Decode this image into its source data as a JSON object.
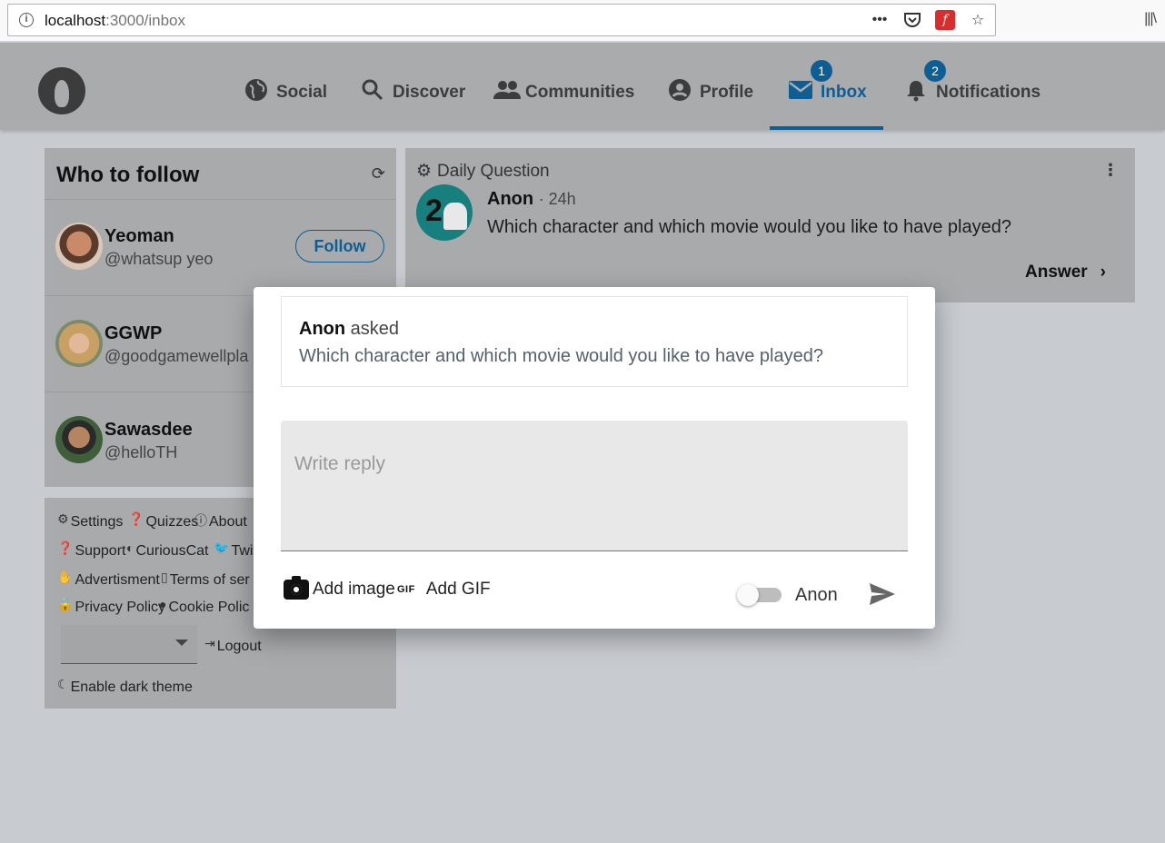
{
  "browser": {
    "url_host": "localhost",
    "url_rest": ":3000/inbox",
    "more_icon": "•••"
  },
  "nav": {
    "items": [
      {
        "label": "Social",
        "icon": "globe-icon"
      },
      {
        "label": "Discover",
        "icon": "search-icon"
      },
      {
        "label": "Communities",
        "icon": "people-icon"
      },
      {
        "label": "Profile",
        "icon": "account-icon"
      },
      {
        "label": "Inbox",
        "icon": "mail-icon",
        "badge": "1",
        "active": true
      },
      {
        "label": "Notifications",
        "icon": "bell-icon",
        "badge": "2"
      }
    ]
  },
  "who_to_follow": {
    "title": "Who to follow",
    "people": [
      {
        "name": "Yeoman",
        "handle": "@whatsup yeo",
        "button": "Follow"
      },
      {
        "name": "GGWP",
        "handle": "@goodgamewellpla"
      },
      {
        "name": "Sawasdee",
        "handle": "@helloTH"
      }
    ]
  },
  "footer_links": {
    "settings": "Settings",
    "quizzes": "Quizzes",
    "about": "About",
    "support": "Support",
    "curiouscat": "CuriousCat",
    "twitter": "Twit",
    "advertisment": "Advertisment",
    "terms": "Terms of ser",
    "privacy": "Privacy Policy",
    "cookie": "Cookie Polic",
    "logout": "Logout",
    "dark_theme": "Enable dark theme"
  },
  "daily_question": {
    "label": "Daily Question",
    "author": "Anon",
    "time": "· 24h",
    "question": "Which character and which movie would you like to have played?",
    "answer": "Answer"
  },
  "modal": {
    "asker": "Anon",
    "asked": "asked",
    "question": "Which character and which movie would you like to have played?",
    "reply_placeholder": "Write reply",
    "add_image": "Add image",
    "gif_icon": "GIF",
    "add_gif": "Add GIF",
    "anon_label": "Anon"
  },
  "colors": {
    "accent": "#0d5e94",
    "overlay_bg": "#c8ccd1"
  }
}
